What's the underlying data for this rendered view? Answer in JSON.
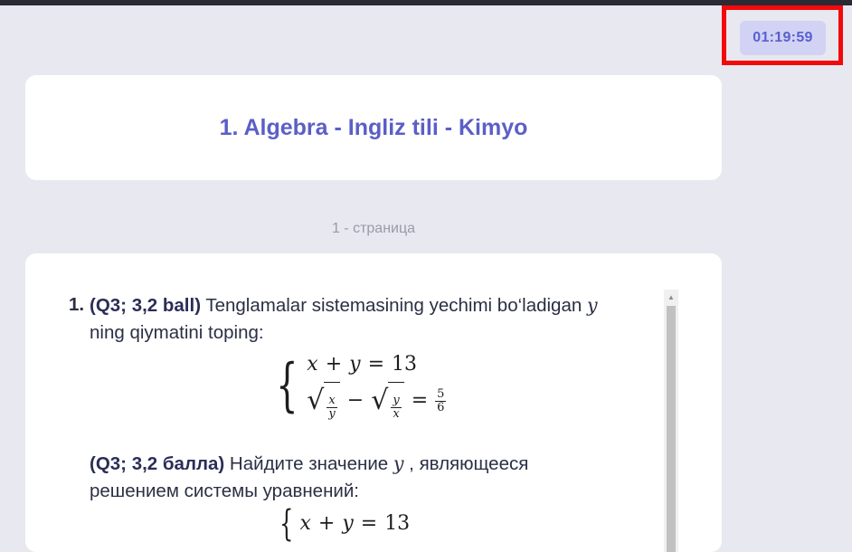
{
  "timer": {
    "value": "01:19:59"
  },
  "header": {
    "title": "1. Algebra - Ingliz tili - Kimyo"
  },
  "page": {
    "label": "1 - страница"
  },
  "question": {
    "number": "1.",
    "uz": {
      "tag": "(Q3; 3,2 ball)",
      "text_before_var": " Tenglamalar sistemasining yechimi bo‘ladigan ",
      "var": "y",
      "text_line2": "ning qiymatini toping:"
    },
    "system": {
      "eq1": {
        "lhs_x": "x",
        "plus": "+",
        "lhs_y": "y",
        "eq": "=",
        "rhs": "13"
      },
      "eq2": {
        "frac1_num": "x",
        "frac1_den": "y",
        "minus": "−",
        "frac2_num": "y",
        "frac2_den": "x",
        "eq": "=",
        "rhs_num": "5",
        "rhs_den": "6"
      }
    },
    "ru": {
      "tag": "(Q3; 3,2 балла)",
      "text_before_var": " Найдите значение ",
      "var": "y",
      "text_after_var": " , являющееся",
      "text_line2": "решением системы уравнений:"
    },
    "system2": {
      "eq1": {
        "lhs_x": "x",
        "plus": "+",
        "lhs_y": "y",
        "eq": "=",
        "rhs": "13"
      }
    }
  },
  "icons": {
    "scroll_up": "scroll-up-arrow-icon"
  }
}
